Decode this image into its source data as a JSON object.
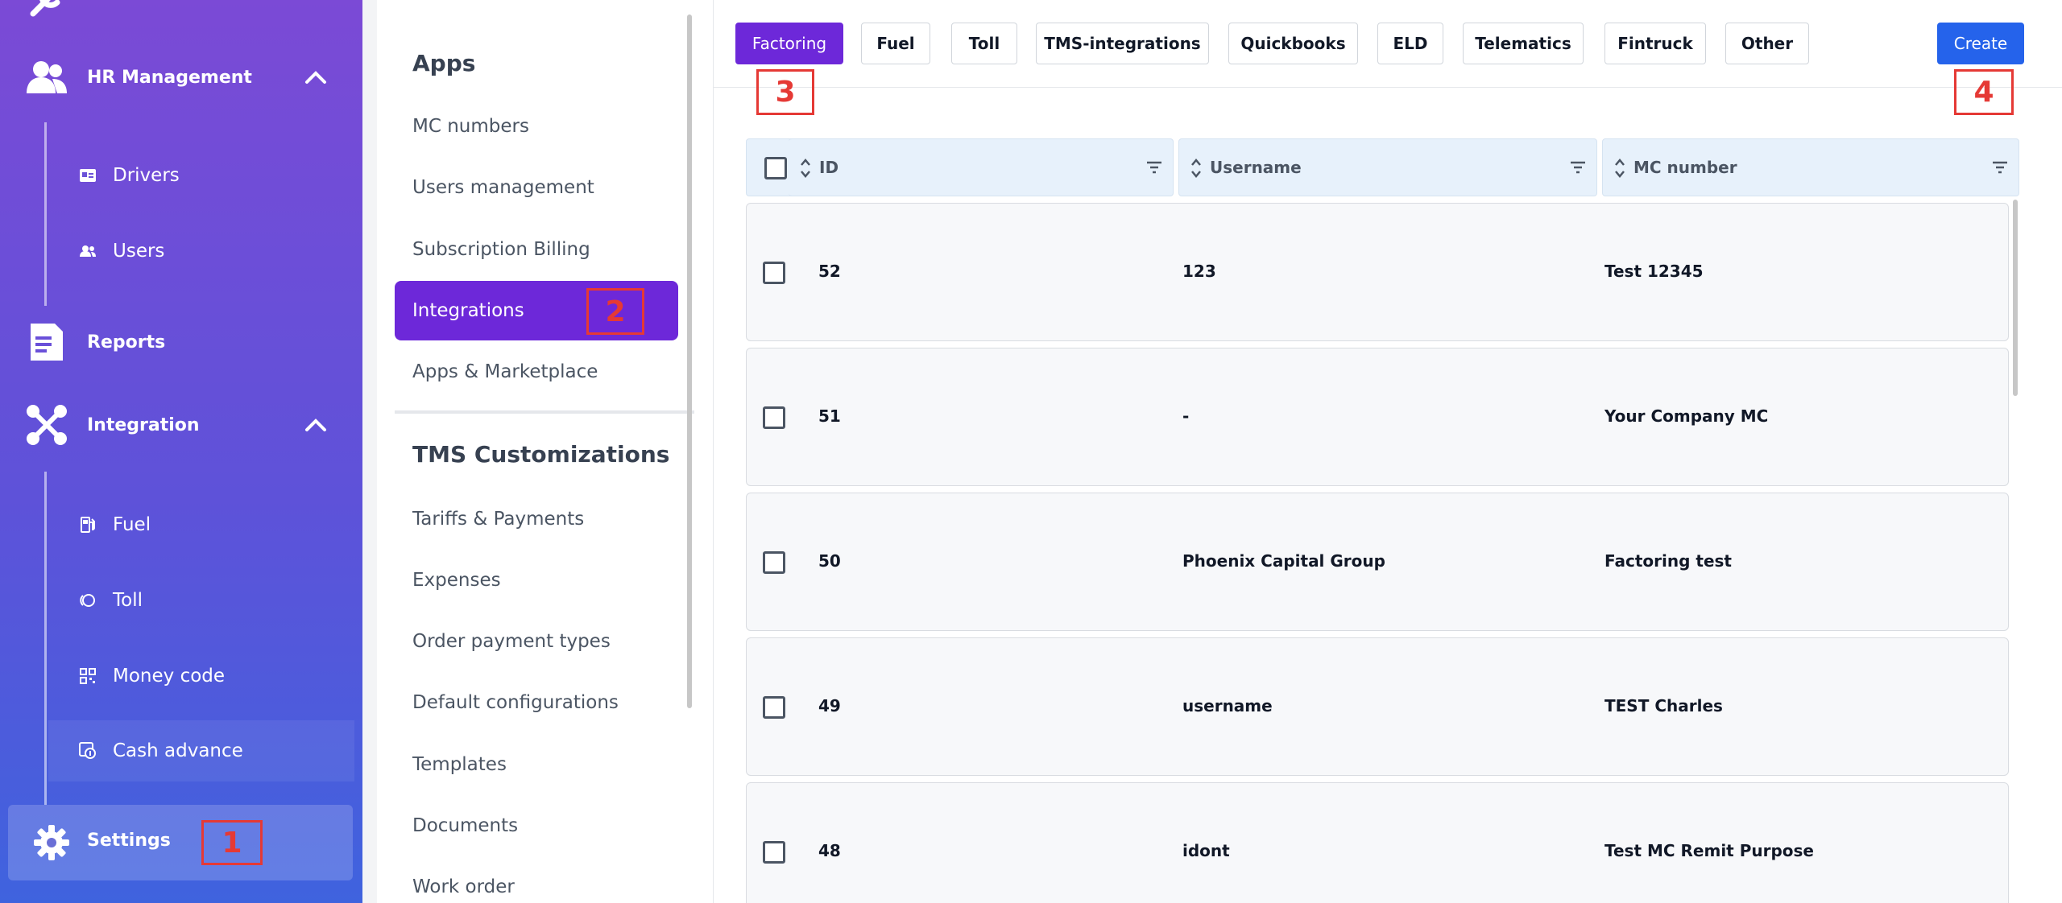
{
  "sidebar": {
    "items": [
      {
        "label": "HR Management",
        "icon": "people-icon",
        "expanded": true
      },
      {
        "label": "Reports",
        "icon": "report-icon"
      },
      {
        "label": "Integration",
        "icon": "integration-icon",
        "expanded": true
      },
      {
        "label": "Settings",
        "icon": "gear-icon"
      }
    ],
    "hr_sub": [
      {
        "label": "Drivers",
        "icon": "id-card-icon"
      },
      {
        "label": "Users",
        "icon": "users-icon"
      }
    ],
    "integration_sub": [
      {
        "label": "Fuel",
        "icon": "fuel-icon"
      },
      {
        "label": "Toll",
        "icon": "toll-icon"
      },
      {
        "label": "Money code",
        "icon": "qr-icon"
      },
      {
        "label": "Cash advance",
        "icon": "cash-icon"
      }
    ]
  },
  "menu": {
    "apps_heading": "Apps",
    "apps_items": [
      "MC numbers",
      "Users management",
      "Subscription Billing",
      "Integrations",
      "Apps & Marketplace"
    ],
    "active_item": "Integrations",
    "tms_heading": "TMS Customizations",
    "tms_items": [
      "Tariffs & Payments",
      "Expenses",
      "Order payment types",
      "Default configurations",
      "Templates",
      "Documents",
      "Work order"
    ]
  },
  "tabs": [
    "Factoring",
    "Fuel",
    "Toll",
    "TMS-integrations",
    "Quickbooks",
    "ELD",
    "Telematics",
    "Fintruck",
    "Other"
  ],
  "active_tab": "Factoring",
  "create_label": "Create",
  "table": {
    "columns": [
      "ID",
      "Username",
      "MC number"
    ],
    "rows": [
      {
        "id": "52",
        "username": "123",
        "mc": "Test 12345"
      },
      {
        "id": "51",
        "username": "-",
        "mc": "Your Company MC"
      },
      {
        "id": "50",
        "username": "Phoenix Capital Group",
        "mc": "Factoring test"
      },
      {
        "id": "49",
        "username": "username",
        "mc": "TEST Charles"
      },
      {
        "id": "48",
        "username": "idont",
        "mc": "Test MC Remit Purpose"
      }
    ]
  },
  "annotations": [
    "1",
    "2",
    "3",
    "4"
  ],
  "colors": {
    "accent": "#6d28d9",
    "primary": "#2563eb",
    "annotation": "#e53935"
  }
}
